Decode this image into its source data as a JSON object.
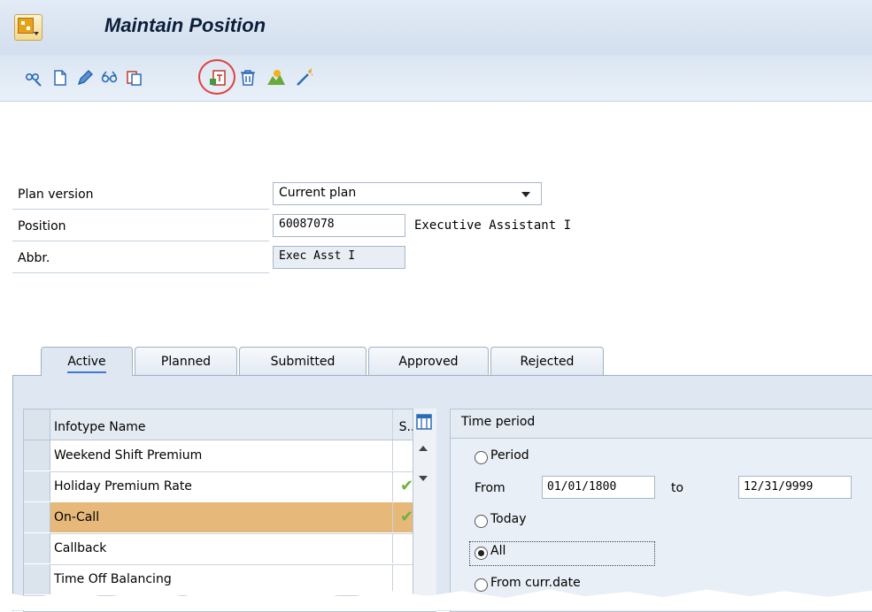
{
  "window": {
    "title": "Maintain Position"
  },
  "toolbar": {
    "buttons": [
      {
        "name": "display-icon"
      },
      {
        "name": "create-icon"
      },
      {
        "name": "change-icon"
      },
      {
        "name": "overview-icon"
      },
      {
        "name": "copy-icon"
      },
      {
        "name": "create-infotype-icon",
        "highlighted": true
      },
      {
        "name": "delete-icon"
      },
      {
        "name": "structure-icon"
      },
      {
        "name": "wizard-icon"
      }
    ],
    "highlight_color": "#e0413e"
  },
  "form": {
    "plan_version": {
      "label": "Plan version",
      "value": "Current plan"
    },
    "position": {
      "label": "Position",
      "value": "60087078",
      "description": "Executive Assistant I"
    },
    "abbr": {
      "label": "Abbr.",
      "value": "Exec Asst I"
    }
  },
  "tabs": [
    {
      "label": "Active",
      "active": true
    },
    {
      "label": "Planned",
      "active": false
    },
    {
      "label": "Submitted",
      "active": false
    },
    {
      "label": "Approved",
      "active": false
    },
    {
      "label": "Rejected",
      "active": false
    }
  ],
  "infotype_table": {
    "headers": {
      "name": "Infotype Name",
      "status": "S.."
    },
    "rows": [
      {
        "name": "Weekend Shift Premium",
        "status": "",
        "selected": false
      },
      {
        "name": "Holiday Premium Rate",
        "status": "✔",
        "selected": false
      },
      {
        "name": "On-Call",
        "status": "✔",
        "selected": true
      },
      {
        "name": "Callback",
        "status": "",
        "selected": false
      },
      {
        "name": "Time Off Balancing",
        "status": "",
        "selected": false
      }
    ]
  },
  "time_period": {
    "title": "Time period",
    "options": {
      "period": "Period",
      "today": "Today",
      "all": "All",
      "from_curr_date": "From curr.date"
    },
    "selected": "all",
    "from_label": "From",
    "from_value": "01/01/1800",
    "to_label": "to",
    "to_value": "12/31/9999"
  },
  "colors": {
    "title_bar": "#d3dfee",
    "selected_row": "#e6b879",
    "check": "#6fb33f",
    "tab_strip": "#dfe8f2"
  }
}
